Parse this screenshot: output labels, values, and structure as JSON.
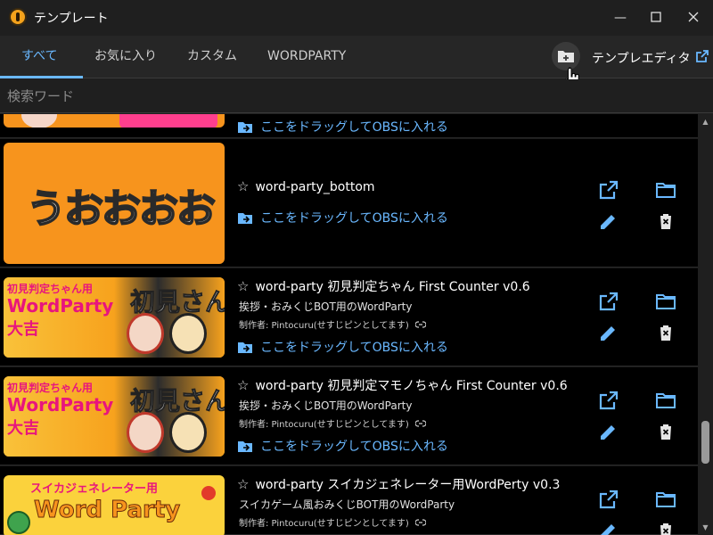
{
  "window": {
    "title": "テンプレート"
  },
  "tabs": [
    {
      "label": "すべて",
      "active": true
    },
    {
      "label": "お気に入り"
    },
    {
      "label": "カスタム"
    },
    {
      "label": "WORDPARTY"
    }
  ],
  "toolbar": {
    "editor_label": "テンプレエディタ"
  },
  "search": {
    "placeholder": "検索ワード"
  },
  "drag_label": "ここをドラッグしてOBSに入れる",
  "thumb_art": {
    "bottom": "うおおおお",
    "counter_top": "初見判定ちゃん用",
    "wordparty": "WordParty",
    "shoken": "初見さん",
    "daikichi": "大吉",
    "suika_top": "スイカジェネレーター用",
    "suika_main": "Word Party"
  },
  "items": [
    {
      "title": "word-party_bottom",
      "description": "",
      "author": ""
    },
    {
      "title": "word-party 初見判定ちゃん First Counter v0.6",
      "description": "挨拶・おみくじBOT用のWordParty",
      "author": "制作者: Pintocuru(せすじピンとしてます)"
    },
    {
      "title": "word-party 初見判定マモノちゃん First Counter v0.6",
      "description": "挨拶・おみくじBOT用のWordParty",
      "author": "制作者: Pintocuru(せすじピンとしてます)"
    },
    {
      "title": "word-party スイカジェネレーター用WordPerty v0.3",
      "description": "スイカゲーム風おみくじBOT用のWordParty",
      "author": "制作者: Pintocuru(せすじピンとしてます)"
    }
  ],
  "colors": {
    "accent": "#6ab8ff",
    "orange": "#f7941d",
    "background": "#000000"
  },
  "icons": [
    "open-in-new-icon",
    "folder-icon",
    "edit-icon",
    "delete-icon",
    "drag-to-obs-icon",
    "star-outline-icon",
    "link-icon",
    "create-folder-icon"
  ]
}
